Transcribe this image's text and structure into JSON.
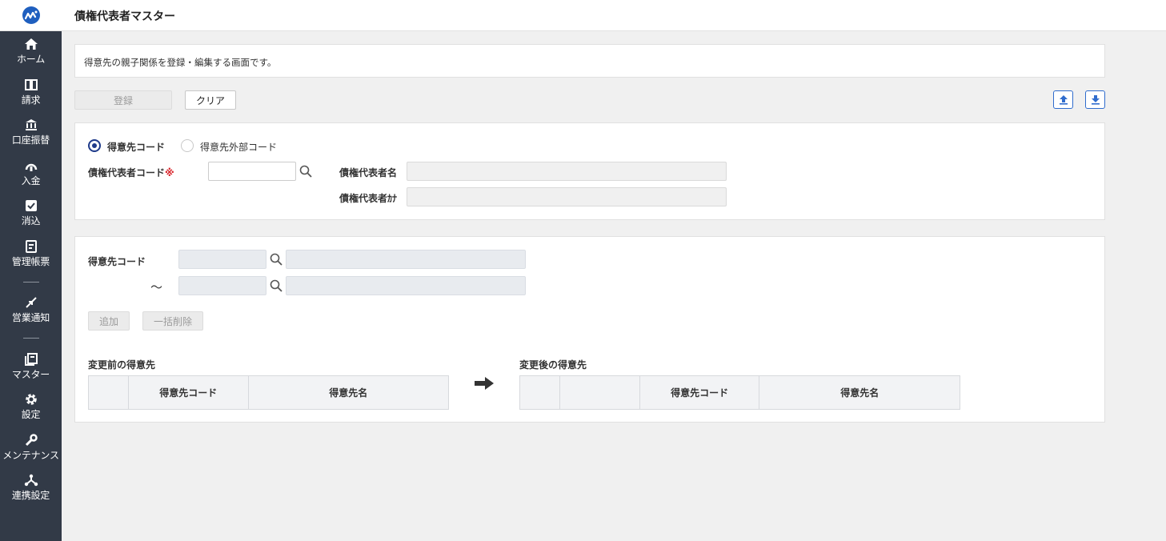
{
  "header": {
    "title": "債権代表者マスター"
  },
  "sidebar": {
    "items": [
      {
        "label": "ホーム",
        "icon": "home-icon"
      },
      {
        "label": "請求",
        "icon": "book-icon"
      },
      {
        "label": "口座振替",
        "icon": "bank-icon"
      },
      {
        "label": "入金",
        "icon": "deposit-icon"
      },
      {
        "label": "消込",
        "icon": "check-icon"
      },
      {
        "label": "管理帳票",
        "icon": "report-icon"
      },
      {
        "label": "営業通知",
        "icon": "arrows-icon"
      },
      {
        "label": "マスター",
        "icon": "library-icon"
      },
      {
        "label": "設定",
        "icon": "gear-icon"
      },
      {
        "label": "メンテナンス",
        "icon": "wrench-icon"
      },
      {
        "label": "連携設定",
        "icon": "network-icon"
      }
    ]
  },
  "description": "得意先の親子関係を登録・編集する画面です。",
  "toolbar": {
    "register_label": "登録",
    "clear_label": "クリア"
  },
  "form": {
    "radio_customer_code": "得意先コード",
    "radio_external_code": "得意先外部コード",
    "rep_code_label": "債権代表者コード",
    "required_mark": "※",
    "rep_code_value": "",
    "rep_name_label": "債権代表者名",
    "rep_name_value": "",
    "rep_kana_label": "債権代表者ｶﾅ",
    "rep_kana_value": ""
  },
  "range": {
    "customer_code_label": "得意先コード",
    "tilde": "～",
    "add_label": "追加",
    "bulk_delete_label": "一括削除"
  },
  "before": {
    "title": "変更前の得意先",
    "columns": [
      "",
      "得意先コード",
      "得意先名"
    ]
  },
  "after": {
    "title": "変更後の得意先",
    "columns": [
      "",
      "",
      "得意先コード",
      "得意先名"
    ]
  },
  "colors": {
    "sidebar_bg": "#323a47",
    "accent": "#1e3a8a",
    "link": "#2f6ccd",
    "required": "#d9262c"
  }
}
